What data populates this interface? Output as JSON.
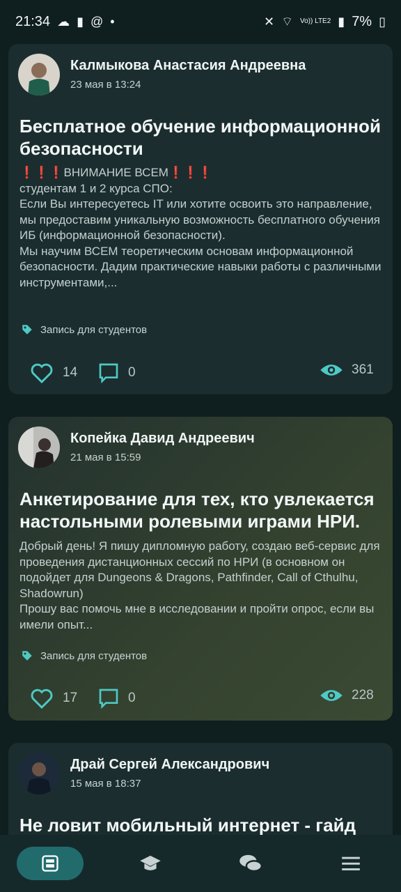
{
  "status_bar": {
    "time": "21:34",
    "battery": "7%",
    "network": "Vo)) LTE2"
  },
  "posts": [
    {
      "author": "Калмыкова Анастасия Андреевна",
      "date": "23 мая в 13:24",
      "title": "Бесплатное обучение информационной безопасности",
      "body": "❗❗❗ВНИМАНИЕ ВСЕМ❗❗❗\nстудентам 1 и 2 курса СПО:\nЕсли Вы интересуетесь IT или хотите освоить это направление, мы предоставим уникальную возможность бесплатного обучения ИБ (информационной безопасности).\nМы научим ВСЕМ теоретическим основам информационной безопасности. Дадим практические навыки работы с различными инструментами,...",
      "tag": "Запись для студентов",
      "likes": "14",
      "comments": "0",
      "views": "361"
    },
    {
      "author": "Копейка Давид Андреевич",
      "date": "21 мая в 15:59",
      "title": "Анкетирование для тех, кто увлекается настольными ролевыми играми НРИ.",
      "body": "Добрый день! Я пишу дипломную работу, создаю веб-сервис для проведения дистанционных сессий по НРИ (в основном он подойдет для Dungeons & Dragons, Pathfinder, Call of Cthulhu, Shadowrun)\nПрошу вас помочь мне в исследовании и пройти опрос, если вы имели опыт...",
      "tag": "Запись для студентов",
      "likes": "17",
      "comments": "0",
      "views": "228"
    },
    {
      "author": "Драй Сергей Александрович",
      "date": "15 мая в 18:37",
      "title": "Не ловит мобильный интернет - гайд"
    }
  ],
  "colors": {
    "accent": "#4fc9c4",
    "active_nav": "#226b6d"
  },
  "nav": [
    "news-icon",
    "education-icon",
    "chat-icon",
    "menu-icon"
  ]
}
